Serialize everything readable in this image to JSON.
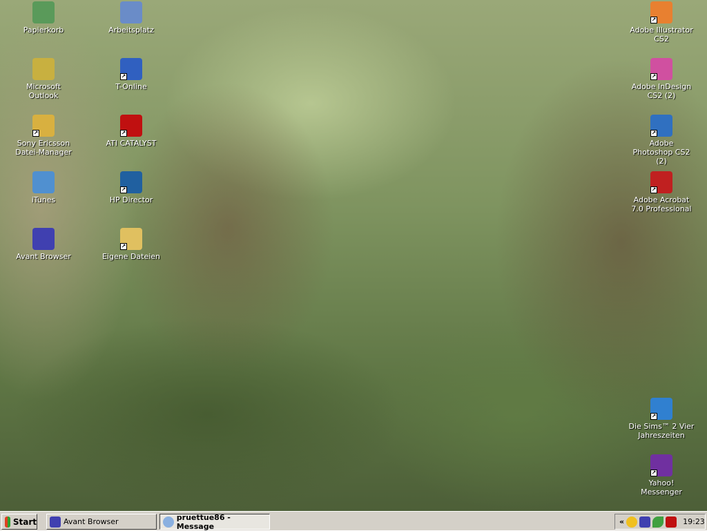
{
  "desktop_icons": [
    {
      "label": "Papierkorb",
      "icon": "recycle-bin-icon",
      "color": "#5a9a5a"
    },
    {
      "label": "Arbeitsplatz",
      "icon": "my-computer-icon",
      "color": "#6a8cc8"
    },
    {
      "label": "Microsoft Outlook",
      "icon": "outlook-icon",
      "color": "#c8b040"
    },
    {
      "label": "T-Online",
      "icon": "t-online-icon",
      "color": "#3060c0"
    },
    {
      "label": "Sony Ericsson Datei-Manager",
      "icon": "phone-folder-icon",
      "color": "#d8b040"
    },
    {
      "label": "ATI CATALYST",
      "icon": "ati-icon",
      "color": "#c01010"
    },
    {
      "label": "iTunes",
      "icon": "itunes-icon",
      "color": "#5090d0"
    },
    {
      "label": "HP Director",
      "icon": "hp-director-icon",
      "color": "#2060a0"
    },
    {
      "label": "Avant Browser",
      "icon": "avant-browser-icon",
      "color": "#4040b0"
    },
    {
      "label": "Eigene Dateien",
      "icon": "my-documents-icon",
      "color": "#e0c060"
    },
    {
      "label": "Adobe Illustrator CS2",
      "icon": "illustrator-icon",
      "color": "#e88030"
    },
    {
      "label": "Adobe InDesign CS2 (2)",
      "icon": "indesign-icon",
      "color": "#d050a0"
    },
    {
      "label": "Adobe Photoshop CS2 (2)",
      "icon": "photoshop-icon",
      "color": "#3070c0"
    },
    {
      "label": "Adobe Acrobat 7.0 Professional",
      "icon": "acrobat-icon",
      "color": "#c02020"
    },
    {
      "label": "Die Sims™ 2 Vier Jahreszeiten",
      "icon": "sims-icon",
      "color": "#3080d0"
    },
    {
      "label": "Yahoo! Messenger",
      "icon": "yahoo-messenger-icon",
      "color": "#7030a0"
    }
  ],
  "taskbar": {
    "start": "Start",
    "tasks": [
      {
        "label": "Avant Browser",
        "active": false
      },
      {
        "label": "pruettue86 - Message",
        "active": true
      }
    ],
    "tray_chevron": "«",
    "clock": "19:23"
  }
}
